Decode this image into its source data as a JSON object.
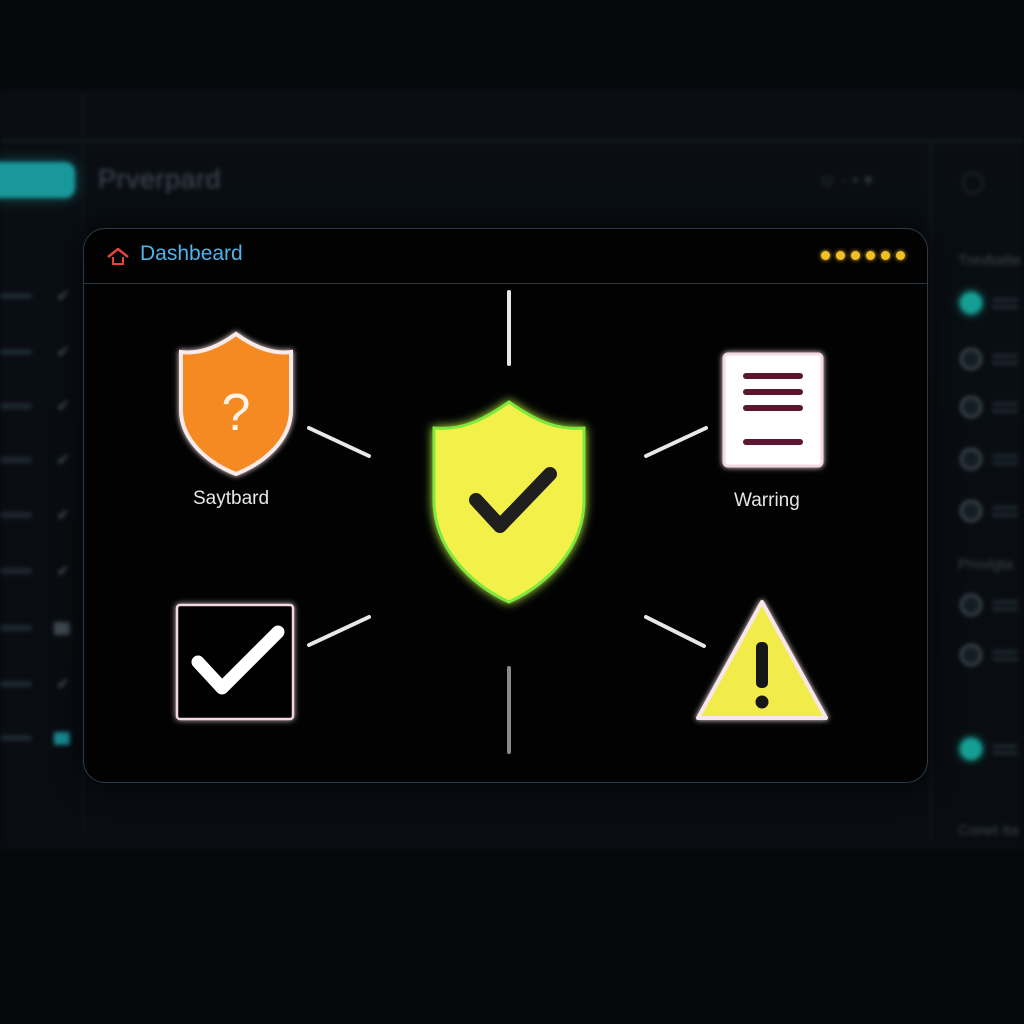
{
  "app": {
    "title": "Prverpard",
    "user_menu_label": "· • ▾"
  },
  "sidebar": {
    "items": [
      {
        "kind": "check"
      },
      {
        "kind": "check"
      },
      {
        "kind": "check"
      },
      {
        "kind": "check"
      },
      {
        "kind": "check"
      },
      {
        "kind": "check"
      },
      {
        "kind": "square"
      },
      {
        "kind": "check"
      },
      {
        "kind": "square-cyan"
      }
    ]
  },
  "right_panel": {
    "section1_title": "Trevbatte",
    "section2_title": "Provigta",
    "section3_title": "Conet ita"
  },
  "card": {
    "title": "Dashbeard",
    "status_dot_count": 6,
    "nodes": {
      "top_left_label": "Saytbard",
      "top_right_label": "Warring"
    }
  },
  "colors": {
    "accent": "#4fb3ec",
    "shield_orange": "#f58a22",
    "shield_yellow": "#f3f14a",
    "warning_yellow": "#f1ec4a",
    "document_lines": "#5b1230",
    "teal": "#1fc9cc",
    "dots": "#f2c026"
  },
  "icons": {
    "home": "home-icon",
    "question_shield": "shield-question-icon",
    "check_shield": "shield-check-icon",
    "document": "document-icon",
    "checkbox": "checkbox-checked-icon",
    "warning": "warning-triangle-icon"
  }
}
